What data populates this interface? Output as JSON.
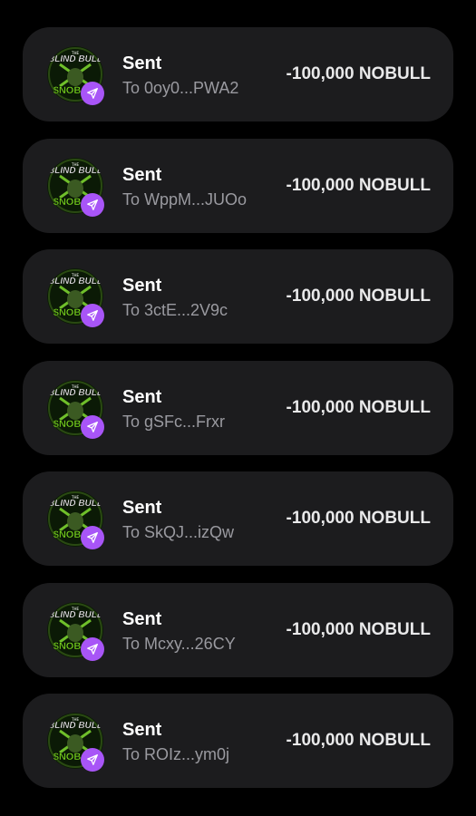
{
  "colors": {
    "background": "#000000",
    "card": "#1c1c1e",
    "badge": "#a855f7",
    "avatar_green": "#7ddc1f"
  },
  "avatar_text": {
    "top": "THE",
    "title": "BLIND BULL",
    "ticker": "$NOB"
  },
  "transactions": [
    {
      "title": "Sent",
      "recipient": "To 0oy0...PWA2",
      "amount": "-100,000 NOBULL",
      "icon": "send-icon"
    },
    {
      "title": "Sent",
      "recipient": "To WppM...JUOo",
      "amount": "-100,000 NOBULL",
      "icon": "send-icon"
    },
    {
      "title": "Sent",
      "recipient": "To 3ctE...2V9c",
      "amount": "-100,000 NOBULL",
      "icon": "send-icon"
    },
    {
      "title": "Sent",
      "recipient": "To gSFc...Frxr",
      "amount": "-100,000 NOBULL",
      "icon": "send-icon"
    },
    {
      "title": "Sent",
      "recipient": "To SkQJ...izQw",
      "amount": "-100,000 NOBULL",
      "icon": "send-icon"
    },
    {
      "title": "Sent",
      "recipient": "To Mcxy...26CY",
      "amount": "-100,000 NOBULL",
      "icon": "send-icon"
    },
    {
      "title": "Sent",
      "recipient": "To ROIz...ym0j",
      "amount": "-100,000 NOBULL",
      "icon": "send-icon"
    }
  ]
}
